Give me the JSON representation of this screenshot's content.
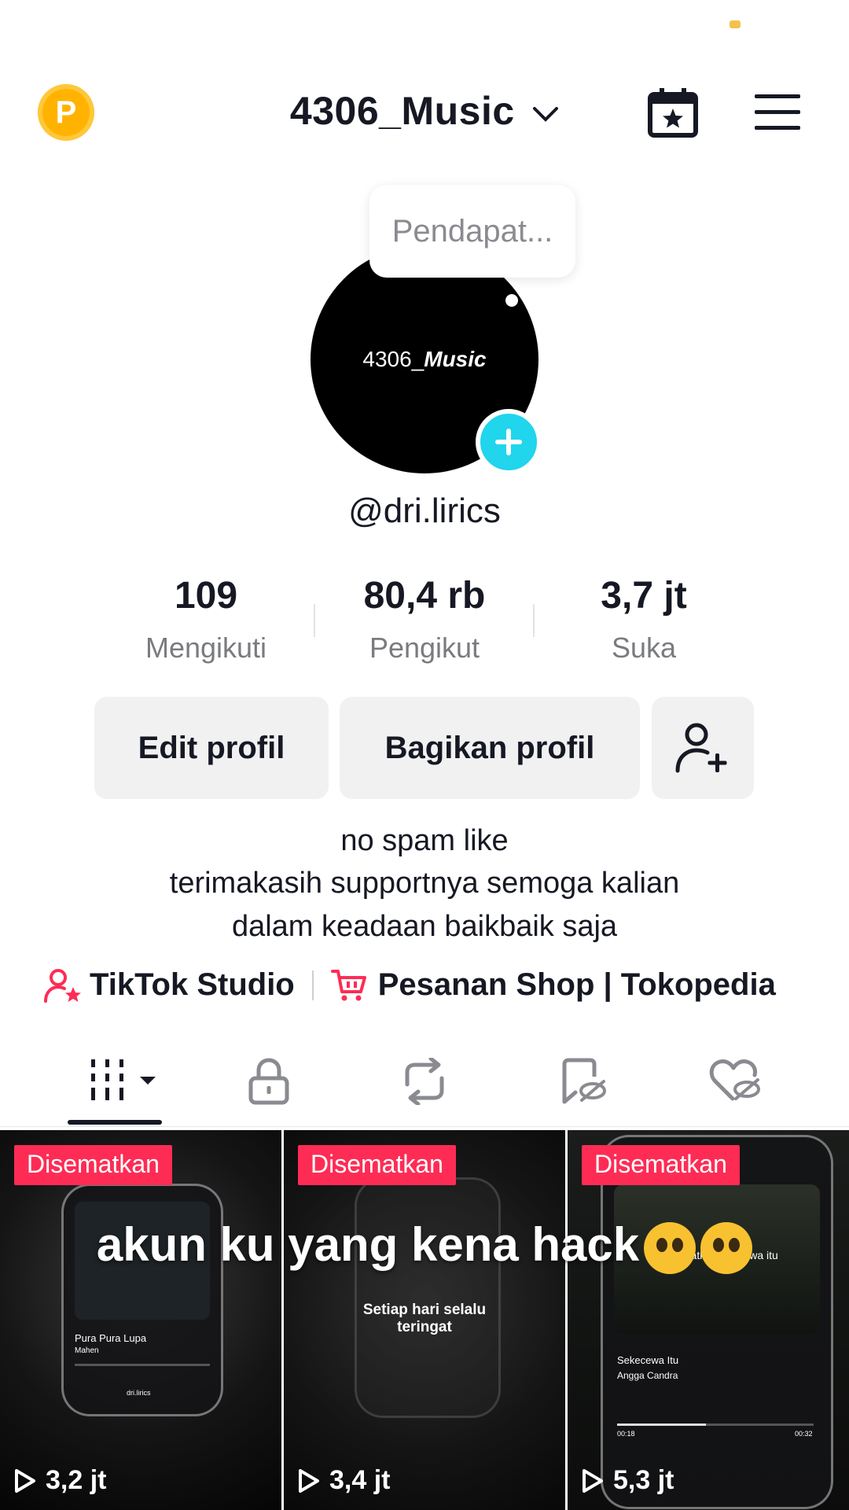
{
  "header": {
    "badge_letter": "P",
    "title": "4306_Music",
    "accent_color": "#ffb300",
    "icons": [
      "calendar-star-icon",
      "hamburger-menu-icon",
      "chevron-down-icon"
    ]
  },
  "profile": {
    "bubble_text": "Pendapat...",
    "avatar_text_left": "4306_",
    "avatar_text_right": "Music",
    "handle": "@dri.lirics",
    "plus_color": "#20d5ec"
  },
  "stats": [
    {
      "value": "109",
      "label": "Mengikuti"
    },
    {
      "value": "80,4 rb",
      "label": "Pengikut"
    },
    {
      "value": "3,7 jt",
      "label": "Suka"
    }
  ],
  "actions": {
    "edit": "Edit profil",
    "share": "Bagikan profil"
  },
  "bio": {
    "line1": "no spam like",
    "line2": "terimakasih supportnya semoga kalian",
    "line3": "dalam keadaan baikbaik saja"
  },
  "links": {
    "studio": "TikTok Studio",
    "shop": "Pesanan Shop | Tokopedia",
    "link_color": "#fe2c55"
  },
  "grid": {
    "overlay": "akun ku yang kena hack",
    "items": [
      {
        "pinned": "Disematkan",
        "views": "3,2 jt",
        "song": "Pura Pura Lupa",
        "artist": "Mahen",
        "credit": "dri.lirics"
      },
      {
        "pinned": "Disematkan",
        "views": "3,4 jt",
        "caption": "Setiap hari selalu\nteringat"
      },
      {
        "pinned": "Disematkan",
        "views": "5,3 jt",
        "caption": "Kau buatku sekecewa itu",
        "song": "Sekecewa Itu",
        "artist": "Angga Candra",
        "time_start": "00:18",
        "time_end": "00:32"
      }
    ]
  }
}
